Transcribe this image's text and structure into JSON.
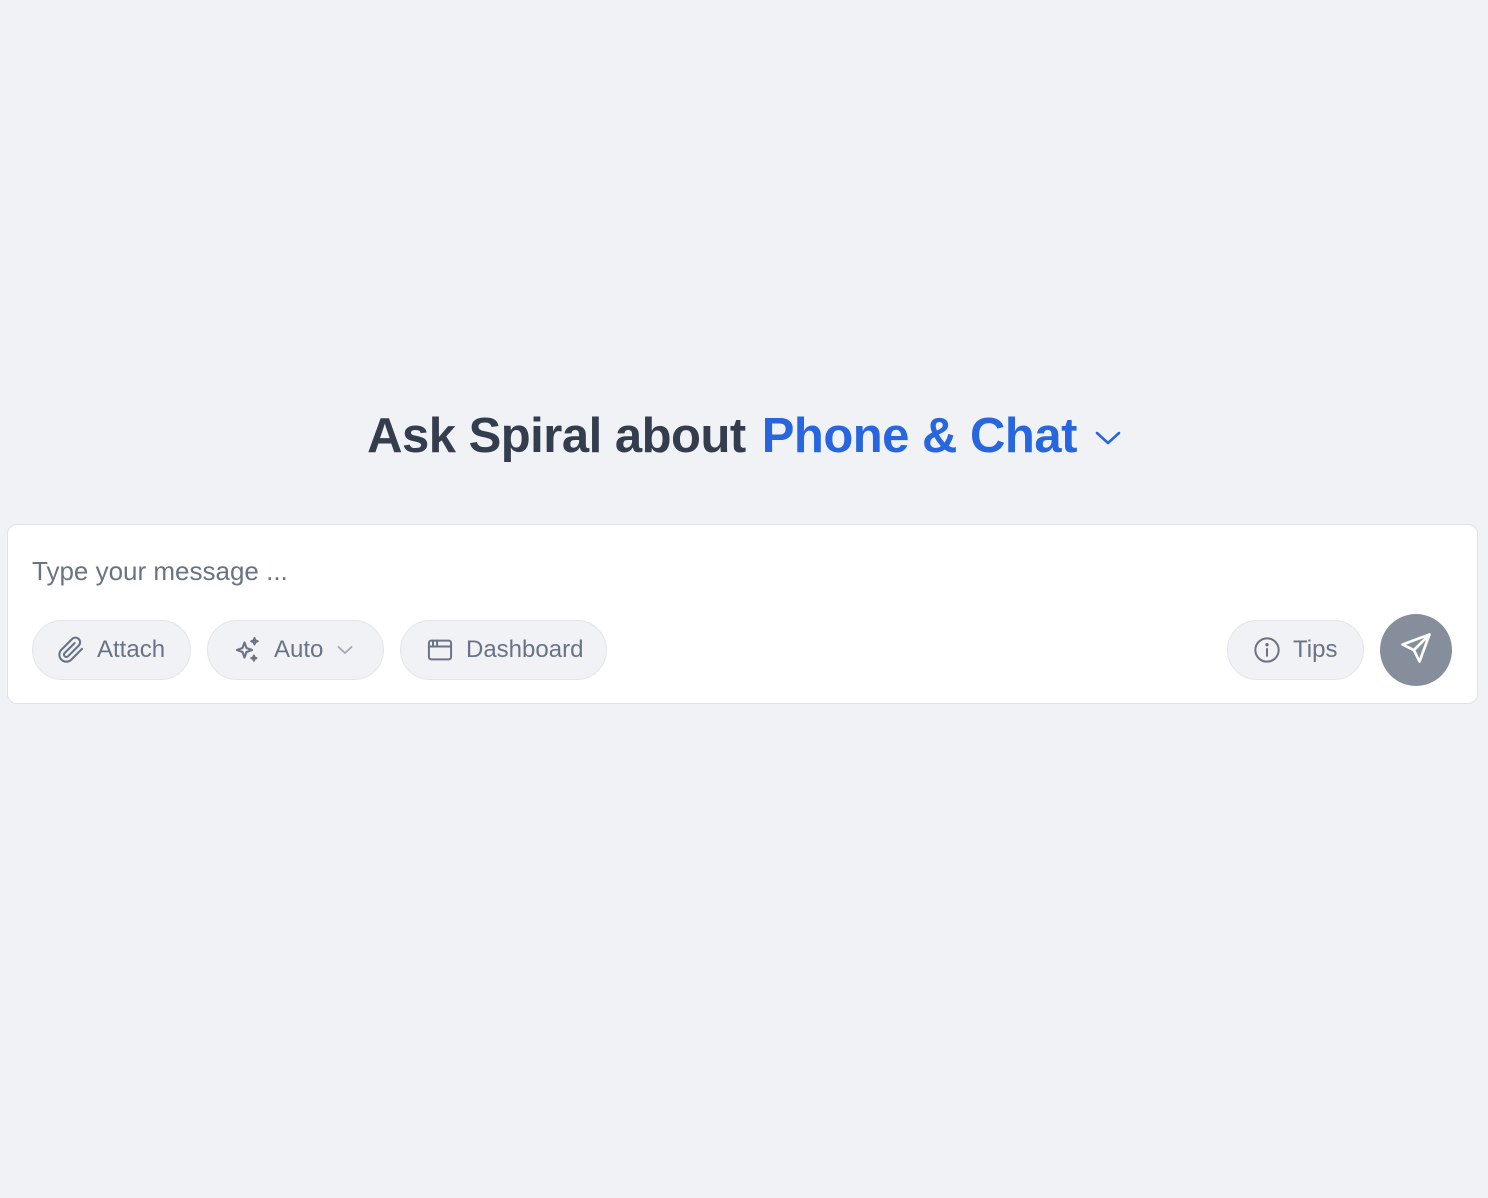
{
  "headline": {
    "prefix": "Ask Spiral about",
    "topic": "Phone & Chat"
  },
  "composer": {
    "placeholder": "Type your message ...",
    "value": "",
    "attach_label": "Attach",
    "mode_label": "Auto",
    "dashboard_label": "Dashboard",
    "tips_label": "Tips"
  },
  "icons": {
    "topic_dropdown": "chevron-down-icon",
    "attach": "paperclip-icon",
    "mode": "sparkles-icon",
    "mode_dropdown": "chevron-down-icon",
    "dashboard": "browser-window-icon",
    "tips": "info-icon",
    "send": "send-icon"
  },
  "colors": {
    "background": "#f0f2f6",
    "accent": "#2766de",
    "heading": "#333d4e",
    "muted_text": "#6a7386",
    "send_button": "#868d9b"
  }
}
